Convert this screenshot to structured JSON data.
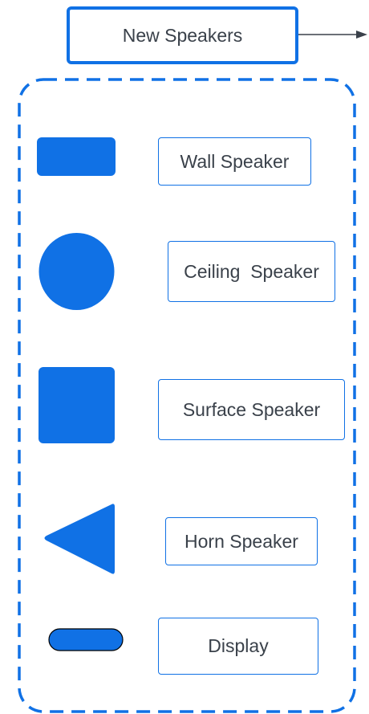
{
  "title": "New Speakers",
  "colors": {
    "accent": "#1071e5",
    "text": "#3a414a",
    "outline": "#000000"
  },
  "legend": [
    {
      "label": "Wall Speaker",
      "symbol": "rounded-rectangle"
    },
    {
      "label": "Ceiling  Speaker",
      "symbol": "circle"
    },
    {
      "label": "Surface Speaker",
      "symbol": "square"
    },
    {
      "label": "Horn Speaker",
      "symbol": "triangle"
    },
    {
      "label": "Display",
      "symbol": "pill"
    }
  ]
}
